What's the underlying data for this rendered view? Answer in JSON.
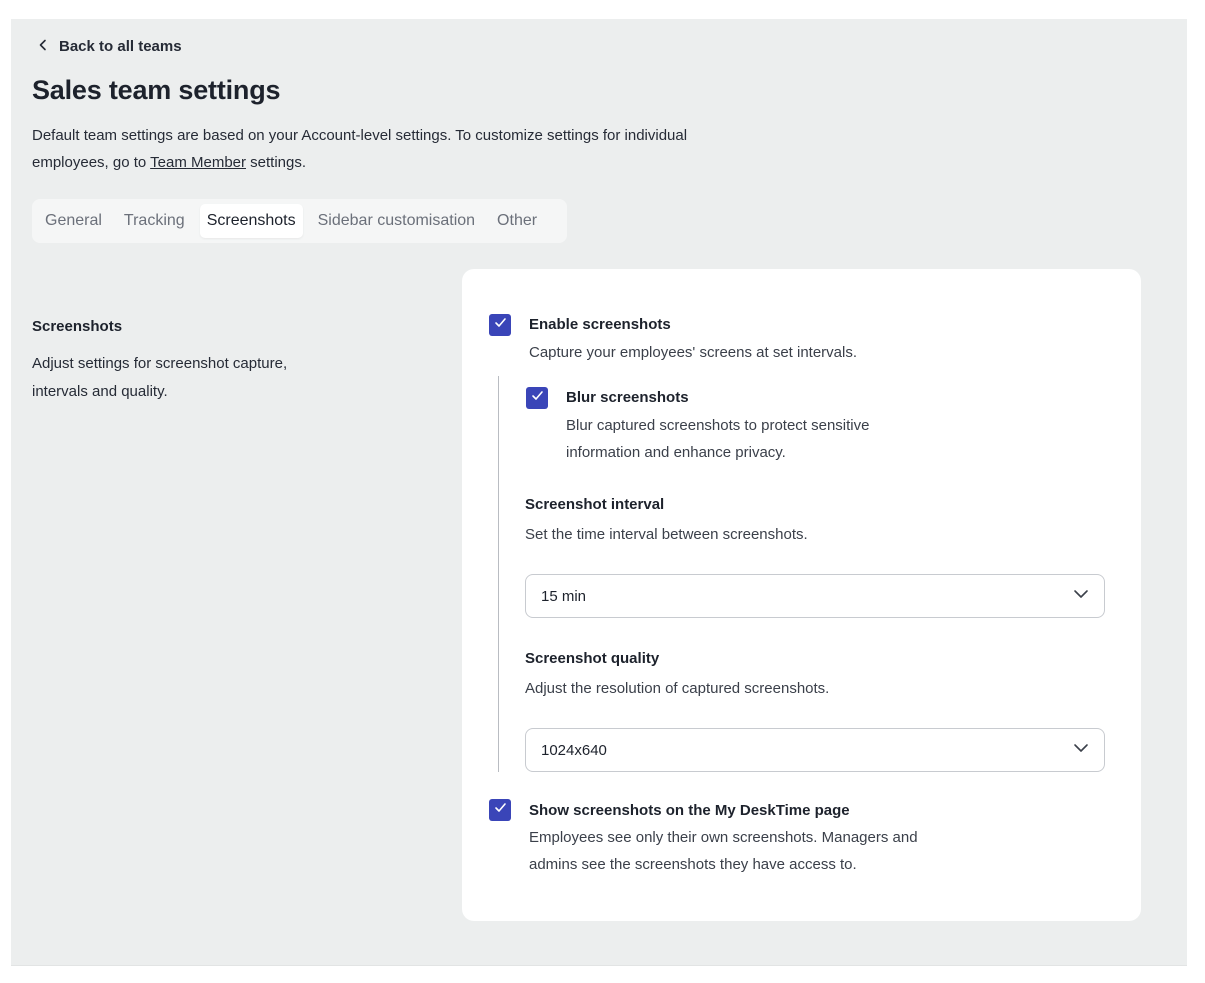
{
  "header": {
    "back_label": "Back to all teams",
    "title": "Sales team settings",
    "description_before": "Default team settings are based on your Account-level settings. To customize settings for individual employees, go to ",
    "description_link": "Team Member",
    "description_after": " settings."
  },
  "tabs": [
    {
      "label": "General",
      "active": false
    },
    {
      "label": "Tracking",
      "active": false
    },
    {
      "label": "Screenshots",
      "active": true
    },
    {
      "label": "Sidebar customisation",
      "active": false
    },
    {
      "label": "Other",
      "active": false
    }
  ],
  "section": {
    "title": "Screenshots",
    "description": "Adjust settings for screenshot capture, intervals and quality."
  },
  "options": {
    "enable": {
      "label": "Enable screenshots",
      "description": "Capture your employees' screens at set intervals.",
      "checked": true
    },
    "blur": {
      "label": "Blur screenshots",
      "description": "Blur captured screenshots to protect sensitive information and enhance privacy.",
      "checked": true
    },
    "interval": {
      "label": "Screenshot interval",
      "description": "Set the time interval between screenshots.",
      "value": "15 min"
    },
    "quality": {
      "label": "Screenshot quality",
      "description": "Adjust the resolution of captured screenshots.",
      "value": "1024x640"
    },
    "show_on_page": {
      "label": "Show screenshots on the My DeskTime page",
      "description": "Employees see only their own screenshots. Managers and admins see the screenshots they have access to.",
      "checked": true
    }
  },
  "icons": {
    "back": "chevron-left-icon",
    "check": "checkmark-icon",
    "dropdown": "chevron-down-icon"
  },
  "colors": {
    "accent": "#3a45b8",
    "page_bg": "#eceeee",
    "card_bg": "#ffffff"
  }
}
